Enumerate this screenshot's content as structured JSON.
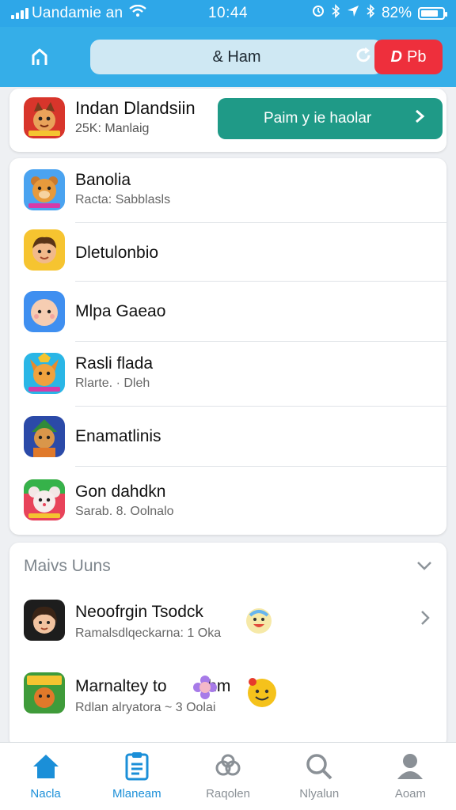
{
  "status_bar": {
    "carrier": "Uandamie an",
    "time": "10:44",
    "battery": "82%",
    "battery_level": 0.82
  },
  "app_bar": {
    "search_text": "& Ham",
    "red_button_label": "Pb",
    "red_button_symbol": "D"
  },
  "featured": {
    "title": "Indan Dlandsiin",
    "subtitle": "25K: Manlaig",
    "cta_label": "Paim y ie haolar"
  },
  "games": [
    {
      "title": "Banolia",
      "subtitle": "Racta: Sabblasls",
      "icon": "bear-icon",
      "color": "#4aa3f0"
    },
    {
      "title": "Dletulonbio",
      "subtitle": "",
      "icon": "boy-icon",
      "color": "#f6c430"
    },
    {
      "title": "Mlpa Gaeao",
      "subtitle": "",
      "icon": "baby-icon",
      "color": "#3f8ff0"
    },
    {
      "title": "Rasli flada",
      "subtitle": "Rlarte. · Dleh",
      "icon": "fox-icon",
      "color": "#2ab6e6"
    },
    {
      "title": "Enamatlinis",
      "subtitle": "",
      "icon": "warrior-icon",
      "color": "#2b4aa8"
    },
    {
      "title": "Gon dahdkn",
      "subtitle": "Sarab. 8. Oolnalo",
      "icon": "mouse-icon",
      "color": "#e8435a"
    }
  ],
  "section": {
    "title": "Maivs Uuns",
    "items": [
      {
        "title": "Neoofrgin Tsodck",
        "subtitle": "Ramalsdlqeckarna: 1 Oka",
        "icon": "girl-icon"
      },
      {
        "title": "Marnaltey to",
        "title_suffix": "hm",
        "subtitle": "Rdlan alryatora ~ 3 Oolai",
        "icon": "frog-icon"
      }
    ]
  },
  "bottom_nav": [
    {
      "label": "Nacla",
      "icon": "home-icon",
      "active": true
    },
    {
      "label": "Mlaneam",
      "icon": "clipboard-icon",
      "active": true
    },
    {
      "label": "Raqolen",
      "icon": "people-icon",
      "active": false
    },
    {
      "label": "Nlyalun",
      "icon": "search-icon",
      "active": false
    },
    {
      "label": "Aoam",
      "icon": "profile-icon",
      "active": false
    }
  ],
  "colors": {
    "header": "#35aee8",
    "cta": "#1f9a87",
    "red_button": "#ee2f3c",
    "nav_active": "#1b8fd8"
  }
}
